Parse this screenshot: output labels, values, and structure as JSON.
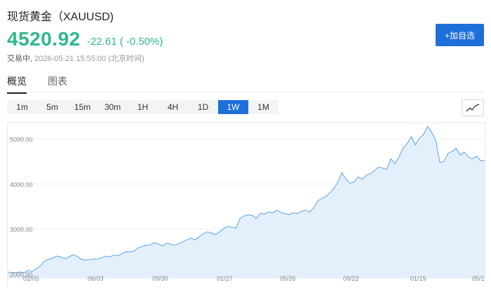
{
  "header": {
    "title": "现货黄金（XAUUSD)",
    "price": "4520.92",
    "change": "-22.61 ( -0.50%)",
    "status_label": "交易中,",
    "timestamp": "2026-05-21 15:55:00 (北京时间)",
    "add_button_label": "+加自选"
  },
  "tabs": [
    {
      "label": "概览",
      "active": true
    },
    {
      "label": "图表",
      "active": false
    }
  ],
  "periods": [
    {
      "label": "1m",
      "active": false
    },
    {
      "label": "5m",
      "active": false
    },
    {
      "label": "15m",
      "active": false
    },
    {
      "label": "30m",
      "active": false
    },
    {
      "label": "1H",
      "active": false
    },
    {
      "label": "4H",
      "active": false
    },
    {
      "label": "1D",
      "active": false
    },
    {
      "label": "1W",
      "active": true
    },
    {
      "label": "1M",
      "active": false
    }
  ],
  "icons": {
    "chart_type": "line-chart-icon"
  },
  "colors": {
    "up_down": "#2eb98a",
    "accent": "#1e6fd9",
    "line": "#5aa3e0",
    "area": "#e3f0fc"
  },
  "chart_data": {
    "type": "area",
    "title": "",
    "ylim": [
      1900,
      5350
    ],
    "y_ticks": [
      "5000.00",
      "4000.00",
      "3000.00",
      "2000.00"
    ],
    "x_ticks": [
      "02/05",
      "06/03",
      "09/30",
      "01/27",
      "05/26",
      "09/22",
      "01/19",
      "05/1"
    ],
    "values": [
      2040,
      2035,
      2030,
      2045,
      2030,
      2080,
      2060,
      2120,
      2180,
      2280,
      2330,
      2350,
      2400,
      2380,
      2340,
      2380,
      2430,
      2400,
      2330,
      2310,
      2320,
      2340,
      2330,
      2360,
      2400,
      2380,
      2420,
      2410,
      2450,
      2500,
      2490,
      2510,
      2580,
      2620,
      2640,
      2650,
      2700,
      2670,
      2620,
      2690,
      2660,
      2640,
      2680,
      2720,
      2760,
      2800,
      2760,
      2830,
      2900,
      2940,
      2910,
      2880,
      2940,
      3010,
      3060,
      3040,
      3020,
      3240,
      3290,
      3320,
      3300,
      3240,
      3350,
      3330,
      3380,
      3360,
      3420,
      3370,
      3340,
      3320,
      3360,
      3340,
      3390,
      3420,
      3380,
      3460,
      3620,
      3680,
      3720,
      3800,
      3900,
      4050,
      4250,
      4100,
      4020,
      4050,
      4160,
      4100,
      4200,
      4230,
      4300,
      4380,
      4350,
      4330,
      4560,
      4450,
      4600,
      4800,
      4900,
      5050,
      4870,
      5020,
      5100,
      5280,
      5150,
      4970,
      4480,
      4500,
      4680,
      4720,
      4790,
      4640,
      4710,
      4600,
      4560,
      4620,
      4520,
      4520
    ]
  }
}
